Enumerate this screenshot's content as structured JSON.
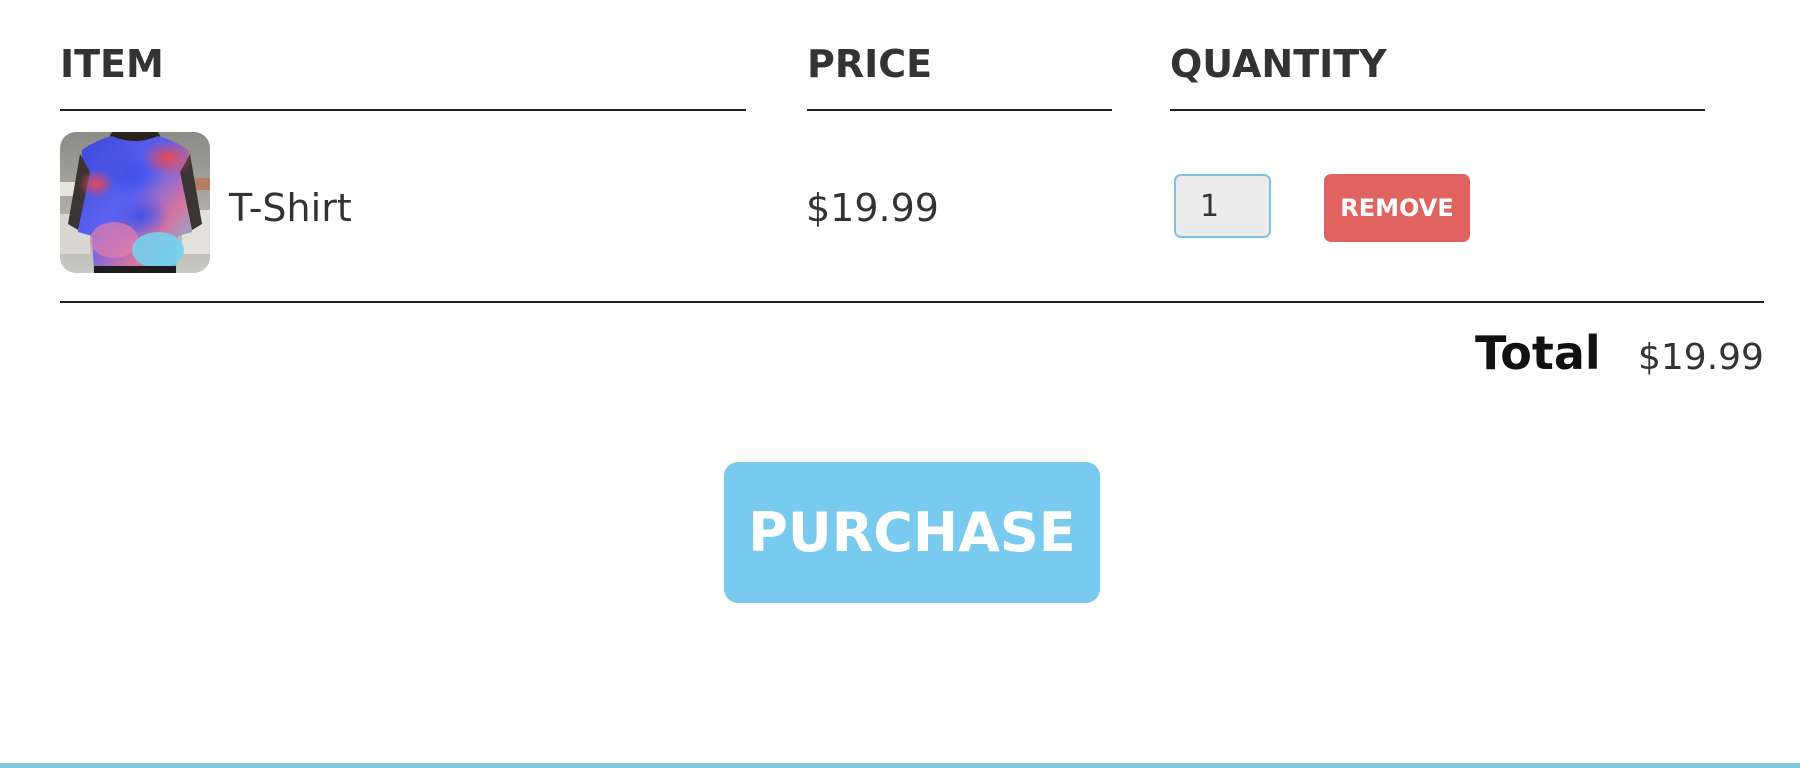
{
  "cart": {
    "headers": {
      "item": "ITEM",
      "price": "PRICE",
      "quantity": "QUANTITY"
    },
    "items": [
      {
        "name": "T-Shirt",
        "price": "$19.99",
        "quantity": "1",
        "remove_label": "REMOVE",
        "image_icon": "tshirt-photo-icon"
      }
    ],
    "total": {
      "label": "Total",
      "value": "$19.99"
    },
    "purchase_label": "PURCHASE"
  },
  "colors": {
    "remove_button": "#e0635f",
    "purchase_button": "#78caee",
    "input_border": "#7cc3e6",
    "accent_bar": "#7cc6d9"
  }
}
